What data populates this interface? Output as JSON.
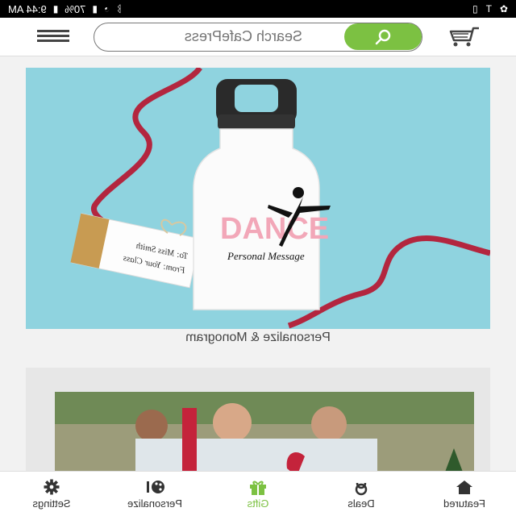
{
  "status_bar": {
    "time": "9:44 AM",
    "battery": "70%",
    "left_icons": [
      "settings-icon",
      "t-icon",
      "vibrate-icon"
    ],
    "right_icons": [
      "bluetooth-icon",
      "wifi-icon",
      "signal-icon",
      "battery-icon"
    ]
  },
  "header": {
    "search_placeholder": "Search CafePress"
  },
  "main": {
    "featured_caption": "Personalize & Monogram",
    "bottle_text_big": "DANCE",
    "bottle_text_small": "Personal Message",
    "tag_text_1": "To: Miss Smith",
    "tag_text_2": "From: Your Class"
  },
  "bottom_nav": {
    "items": [
      {
        "label": "Featured",
        "icon": "home-icon"
      },
      {
        "label": "Deals",
        "icon": "deals-icon"
      },
      {
        "label": "Gifts",
        "icon": "gift-icon"
      },
      {
        "label": "Personalize",
        "icon": "palette-icon"
      },
      {
        "label": "Settings",
        "icon": "gear-icon"
      }
    ],
    "active_index": 2
  },
  "colors": {
    "accent_green": "#7cc142",
    "status_bar_bg": "#000000",
    "card_bg_teal": "#8fd3df"
  }
}
